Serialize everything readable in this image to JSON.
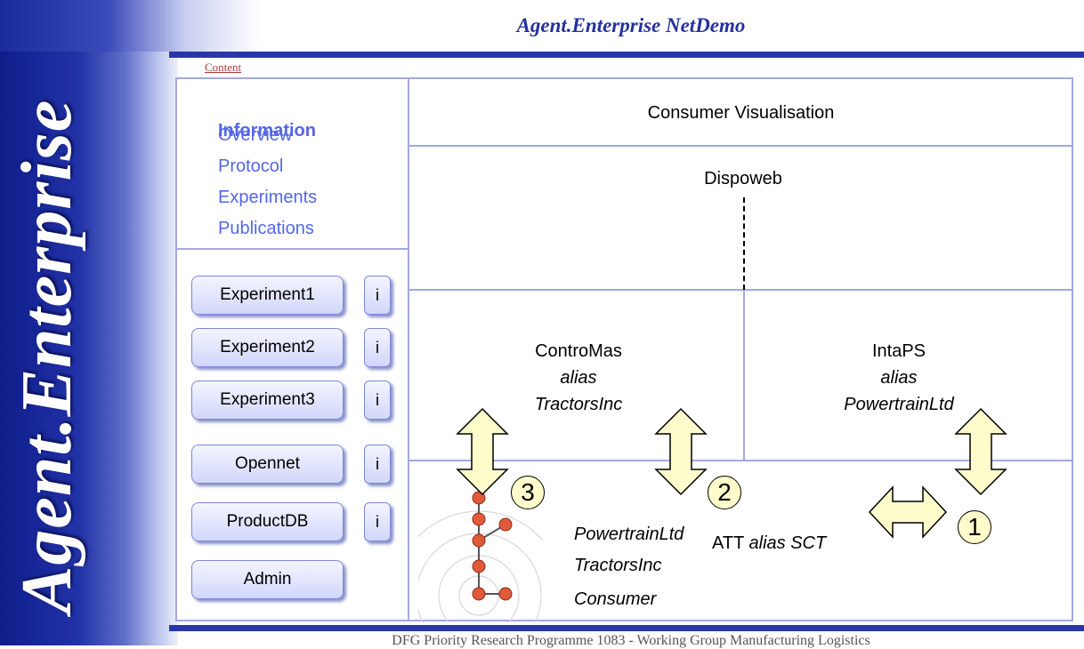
{
  "header": {
    "title": "Agent.Enterprise NetDemo",
    "banner": "Agent.Enterprise"
  },
  "nav": {
    "content_link": "Content"
  },
  "info_menu": {
    "heading": "Information",
    "items": [
      "Overview",
      "Protocol",
      "Experiments",
      "Publications"
    ]
  },
  "buttons": {
    "experiment1": "Experiment1",
    "experiment2": "Experiment2",
    "experiment3": "Experiment3",
    "opennet": "Opennet",
    "productdb": "ProductDB",
    "admin": "Admin",
    "info": "i"
  },
  "panels": {
    "consumer_visualisation": "Consumer Visualisation",
    "dispoweb": "Dispoweb",
    "contromas": {
      "name": "ControMas",
      "alias_word": "alias",
      "alias": "TractorsInc"
    },
    "intaps": {
      "name": "IntaPS",
      "alias_word": "alias",
      "alias": "PowertrainLtd"
    },
    "att": {
      "name": "ATT",
      "alias": "alias SCT"
    },
    "legend": [
      "PowertrainLtd",
      "TractorsInc",
      "Consumer"
    ],
    "markers": [
      "3",
      "2",
      "1"
    ]
  },
  "footer": {
    "text": "DFG Priority Research Programme 1083 - Working Group Manufacturing Logistics"
  }
}
